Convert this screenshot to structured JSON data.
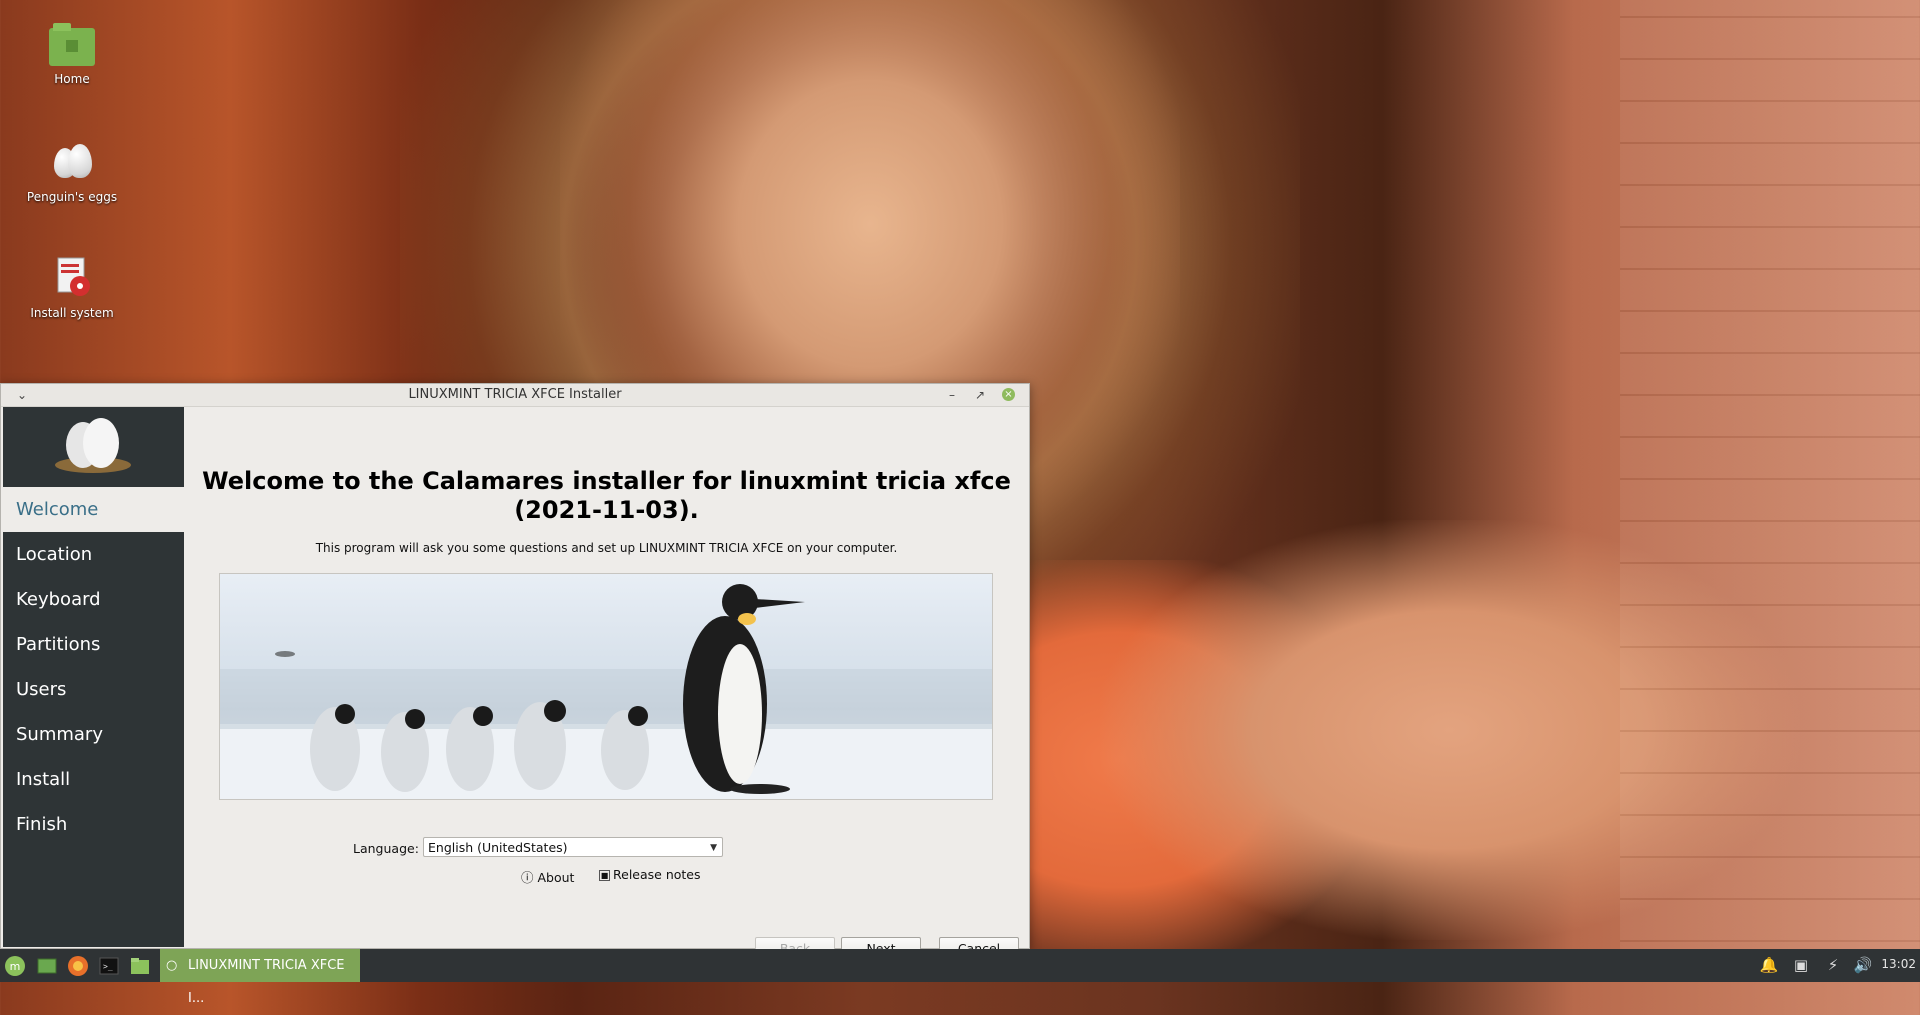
{
  "desktop": {
    "icons": [
      {
        "label": "Home",
        "icon": "home-folder-icon"
      },
      {
        "label": "Penguin's eggs",
        "icon": "penguin-eggs-icon"
      },
      {
        "label": "Install system",
        "icon": "install-system-icon"
      }
    ]
  },
  "window": {
    "title": "LINUXMINT TRICIA XFCE Installer",
    "sidebar": {
      "items": [
        {
          "label": "Welcome",
          "active": true
        },
        {
          "label": "Location"
        },
        {
          "label": "Keyboard"
        },
        {
          "label": "Partitions"
        },
        {
          "label": "Users"
        },
        {
          "label": "Summary"
        },
        {
          "label": "Install"
        },
        {
          "label": "Finish"
        }
      ]
    },
    "content": {
      "heading": "Welcome to the Calamares installer for linuxmint tricia xfce (2021-11-03).",
      "subtitle": "This program will ask you some questions and set up LINUXMINT TRICIA XFCE on your computer.",
      "language_label": "Language:",
      "language_value": "English (UnitedStates)",
      "about_label": "About",
      "release_notes_label": "Release notes"
    },
    "buttons": {
      "back": "Back",
      "next": "Next",
      "cancel": "Cancel"
    }
  },
  "taskbar": {
    "active_task": "LINUXMINT TRICIA XFCE I...",
    "clock": "13:02"
  }
}
